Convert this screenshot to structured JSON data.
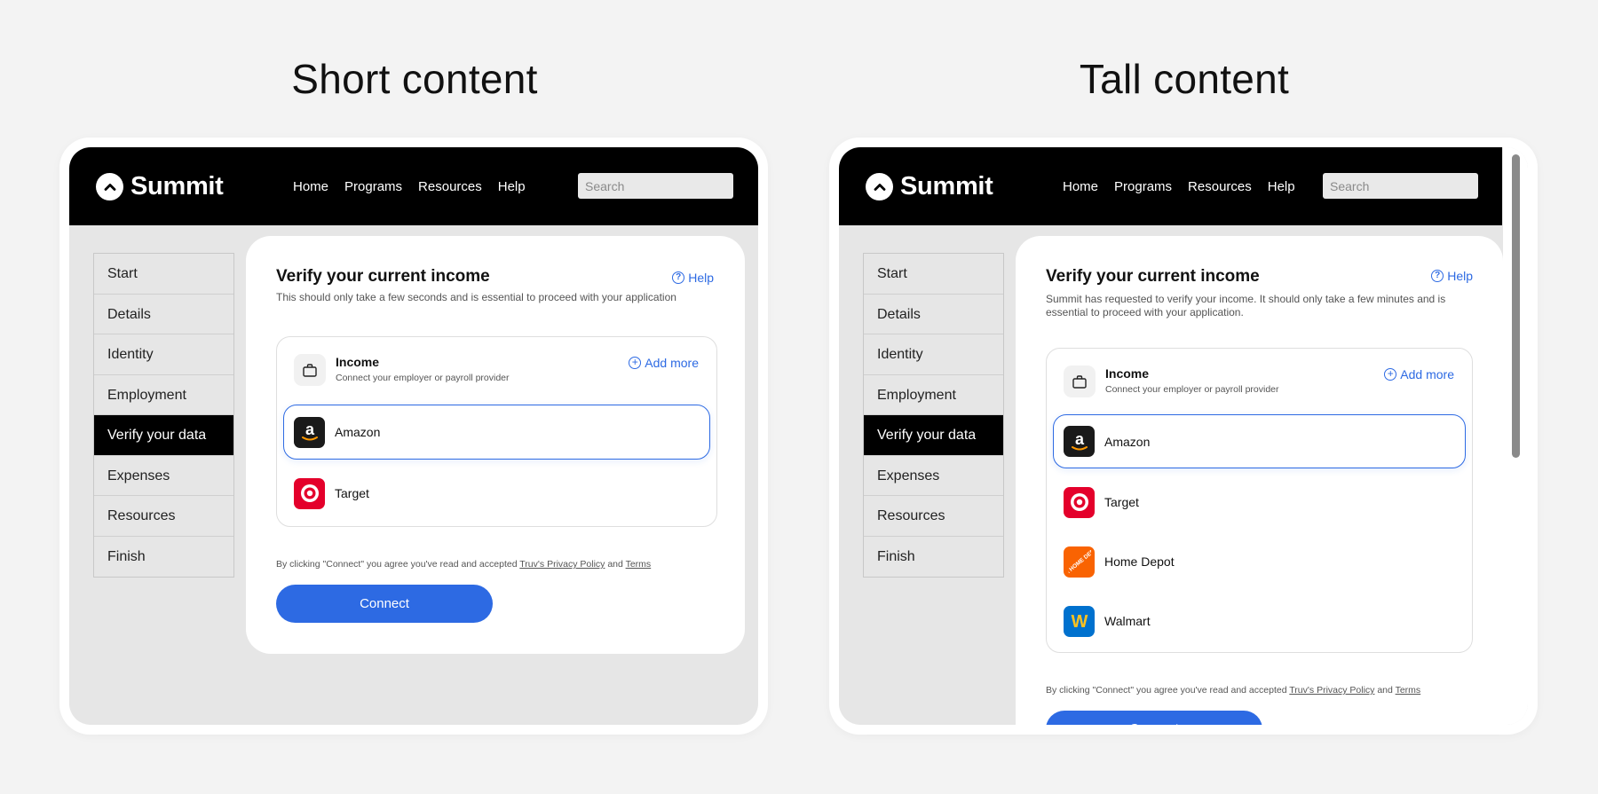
{
  "left": {
    "heading": "Short content",
    "brand": "Summit",
    "nav": [
      "Home",
      "Programs",
      "Resources",
      "Help"
    ],
    "search_placeholder": "Search",
    "steps": [
      "Start",
      "Details",
      "Identity",
      "Employment",
      "Verify your data",
      "Expenses",
      "Resources",
      "Finish"
    ],
    "active_step": "Verify your data",
    "card": {
      "title": "Verify your current income",
      "subtitle": "This should only take a few seconds and is essential to proceed with your application",
      "help": "Help",
      "income_title": "Income",
      "income_sub": "Connect your employer or payroll provider",
      "add_more": "Add more",
      "employers": [
        "Amazon",
        "Target"
      ],
      "selected_employer": "Amazon",
      "terms_prefix": "By clicking \"Connect\" you agree you've read and accepted ",
      "privacy_link": "Truv's Privacy Policy",
      "terms_and": " and ",
      "terms_link": "Terms",
      "connect": "Connect"
    }
  },
  "right": {
    "heading": "Tall content",
    "brand": "Summit",
    "nav": [
      "Home",
      "Programs",
      "Resources",
      "Help"
    ],
    "search_placeholder": "Search",
    "steps": [
      "Start",
      "Details",
      "Identity",
      "Employment",
      "Verify your data",
      "Expenses",
      "Resources",
      "Finish"
    ],
    "active_step": "Verify your data",
    "card": {
      "title": "Verify your current income",
      "subtitle": "Summit has requested to verify your income. It should only take a few minutes and is essential to proceed with your application.",
      "help": "Help",
      "income_title": "Income",
      "income_sub": "Connect your employer or payroll provider",
      "add_more": "Add more",
      "employers": [
        "Amazon",
        "Target",
        "Home Depot",
        "Walmart"
      ],
      "selected_employer": "Amazon",
      "terms_prefix": "By clicking \"Connect\" you agree you've read and accepted ",
      "privacy_link": "Truv's Privacy Policy",
      "terms_and": " and ",
      "terms_link": "Terms",
      "connect": "Connect"
    }
  },
  "logo_glyphs": {
    "amazon": "a",
    "walmart": "W",
    "home_depot": "THE HOME DEPOT"
  },
  "colors": {
    "accent": "#2d6ae3",
    "header": "#000000",
    "amazon": "#1a1a1a",
    "target": "#e4002b",
    "home_depot": "#f96302",
    "walmart": "#0071ce",
    "walmart_spark": "#ffc220"
  }
}
